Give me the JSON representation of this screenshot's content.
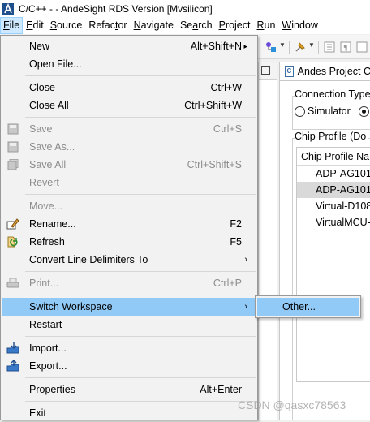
{
  "window": {
    "title": "C/C++ -  - AndeSight RDS Version [Mvsilicon]"
  },
  "menubar": [
    {
      "pre": "",
      "ul": "F",
      "post": "ile",
      "active": true
    },
    {
      "pre": "",
      "ul": "E",
      "post": "dit"
    },
    {
      "pre": "",
      "ul": "S",
      "post": "ource"
    },
    {
      "pre": "Refac",
      "ul": "t",
      "post": "or"
    },
    {
      "pre": "",
      "ul": "N",
      "post": "avigate"
    },
    {
      "pre": "Se",
      "ul": "a",
      "post": "rch"
    },
    {
      "pre": "",
      "ul": "P",
      "post": "roject"
    },
    {
      "pre": "",
      "ul": "R",
      "post": "un"
    },
    {
      "pre": "",
      "ul": "W",
      "post": "indow"
    }
  ],
  "file_menu": {
    "new": {
      "label": "New",
      "shortcut": "Alt+Shift+N",
      "arrow": "▸"
    },
    "open_file": {
      "label": "Open File..."
    },
    "close": {
      "label": "Close",
      "shortcut": "Ctrl+W"
    },
    "close_all": {
      "label": "Close All",
      "shortcut": "Ctrl+Shift+W"
    },
    "save": {
      "label": "Save",
      "shortcut": "Ctrl+S"
    },
    "save_as": {
      "label": "Save As..."
    },
    "save_all": {
      "label": "Save All",
      "shortcut": "Ctrl+Shift+S"
    },
    "revert": {
      "label": "Revert"
    },
    "move": {
      "label": "Move..."
    },
    "rename": {
      "label": "Rename...",
      "shortcut": "F2"
    },
    "refresh": {
      "label": "Refresh",
      "shortcut": "F5"
    },
    "convert": {
      "label": "Convert Line Delimiters To",
      "arrow": "›"
    },
    "print": {
      "label": "Print...",
      "shortcut": "Ctrl+P"
    },
    "switch_workspace": {
      "label": "Switch Workspace",
      "arrow": "›"
    },
    "restart": {
      "label": "Restart"
    },
    "import": {
      "label": "Import..."
    },
    "export": {
      "label": "Export..."
    },
    "properties": {
      "label": "Properties",
      "shortcut": "Alt+Enter"
    },
    "exit": {
      "label": "Exit"
    }
  },
  "submenu": {
    "other": "Other..."
  },
  "editor": {
    "tab_label": "Andes Project C",
    "connection_type_label": "Connection Type",
    "simulator_label": "Simulator",
    "chip_profile_label": "Chip Profile (Do",
    "chip_table_header": "Chip Profile Na",
    "chip_rows": [
      "ADP-AG101",
      "ADP-AG101",
      "Virtual-D108",
      "VirtualMCU-"
    ],
    "selected_row_index": 1
  },
  "watermark": "CSDN @qasxc78563"
}
